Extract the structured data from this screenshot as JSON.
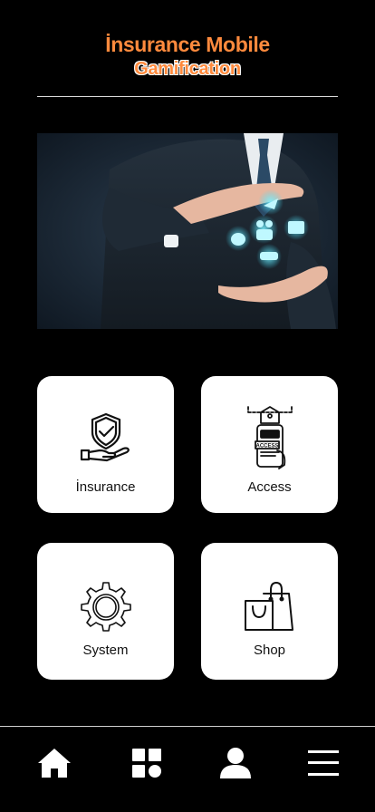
{
  "header": {
    "title_line1": "İnsurance Mobile",
    "title_line2": "Gamification"
  },
  "hero": {
    "image": "insurance-protection-hands-illustration"
  },
  "colors": {
    "background": "#000000",
    "accent": "#ff8a3d",
    "card": "#ffffff",
    "icon_glow": "#3fe0ff"
  },
  "menu": {
    "items": [
      {
        "label": "İnsurance",
        "icon": "hand-shield-check-icon"
      },
      {
        "label": "Access",
        "icon": "access-pass-tag-icon"
      },
      {
        "label": "System",
        "icon": "gear-icon"
      },
      {
        "label": "Shop",
        "icon": "shopping-bags-icon"
      }
    ]
  },
  "tabbar": {
    "items": [
      {
        "icon": "home-icon"
      },
      {
        "icon": "dashboard-grid-icon"
      },
      {
        "icon": "user-icon"
      },
      {
        "icon": "hamburger-menu-icon"
      }
    ]
  }
}
